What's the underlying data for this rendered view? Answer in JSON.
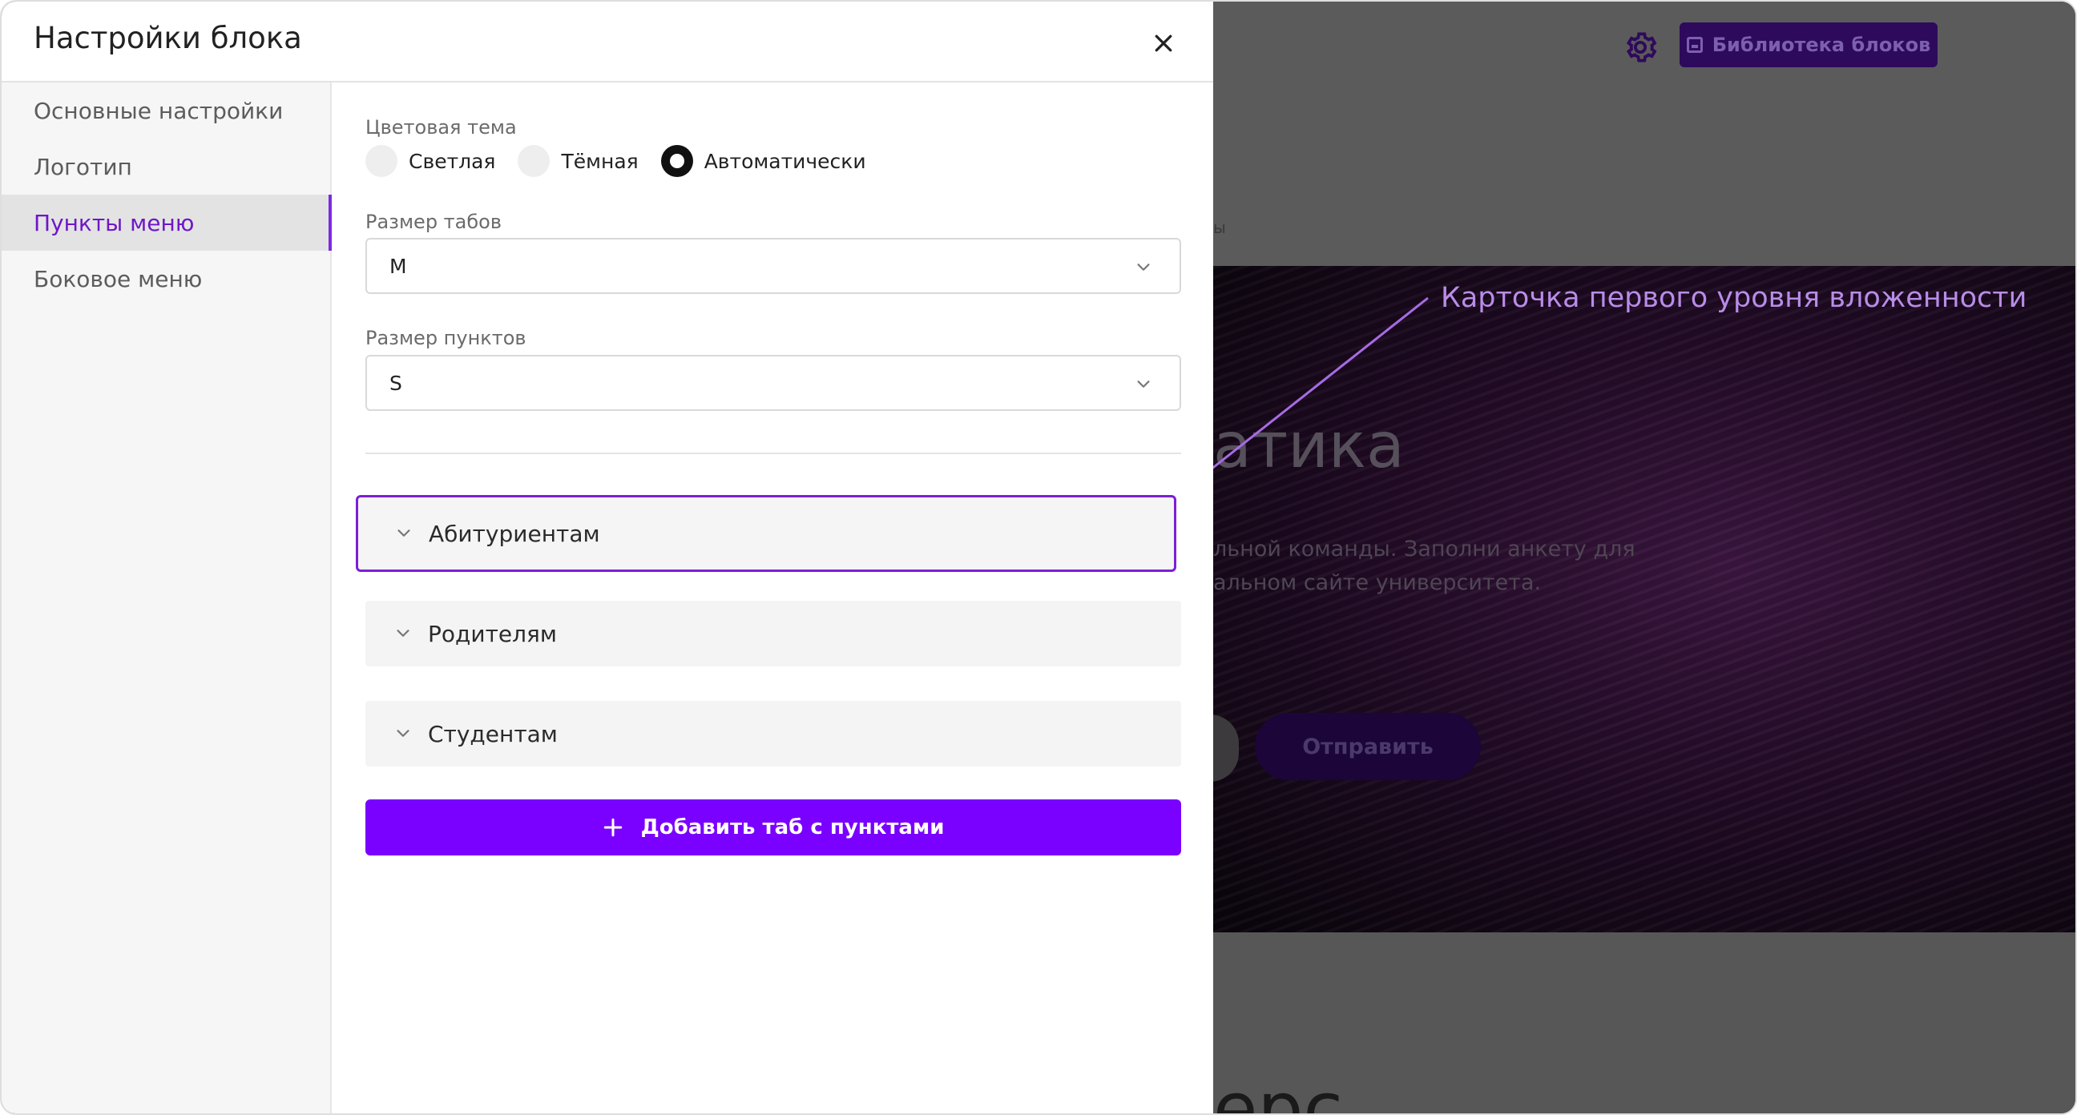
{
  "modal": {
    "title": "Настройки блока",
    "sidebar": {
      "items": [
        {
          "label": "Основные настройки"
        },
        {
          "label": "Логотип"
        },
        {
          "label": "Пункты меню"
        },
        {
          "label": "Боковое меню"
        }
      ],
      "active": "Пункты меню"
    },
    "color_theme": {
      "label": "Цветовая тема",
      "options": [
        "Светлая",
        "Тёмная",
        "Автоматически"
      ],
      "selected": "Автоматически"
    },
    "tabs_size": {
      "label": "Размер табов",
      "value": "M"
    },
    "items_size": {
      "label": "Размер пунктов",
      "value": "S"
    },
    "tabs": [
      {
        "label": "Абитуриентам",
        "highlighted": true
      },
      {
        "label": "Родителям",
        "highlighted": false
      },
      {
        "label": "Студентам",
        "highlighted": false
      }
    ],
    "add_tab_label": "Добавить таб с пунктами"
  },
  "background": {
    "library_button": "Библиотека блоков",
    "hero_title": "атика",
    "hero_text_1": "льной команды. Заполни анкету для",
    "hero_text_2": "альном сайте университета.",
    "send_button": "Отправить",
    "header_dots": "ы",
    "bottom_text": "ерс"
  },
  "annotation": {
    "label": "Карточка первого уровня вложенности",
    "color": "#b98ce8"
  },
  "colors": {
    "accent": "#7a00ff",
    "active_text": "#6e17c8",
    "highlight_border": "#7c1fd6"
  }
}
